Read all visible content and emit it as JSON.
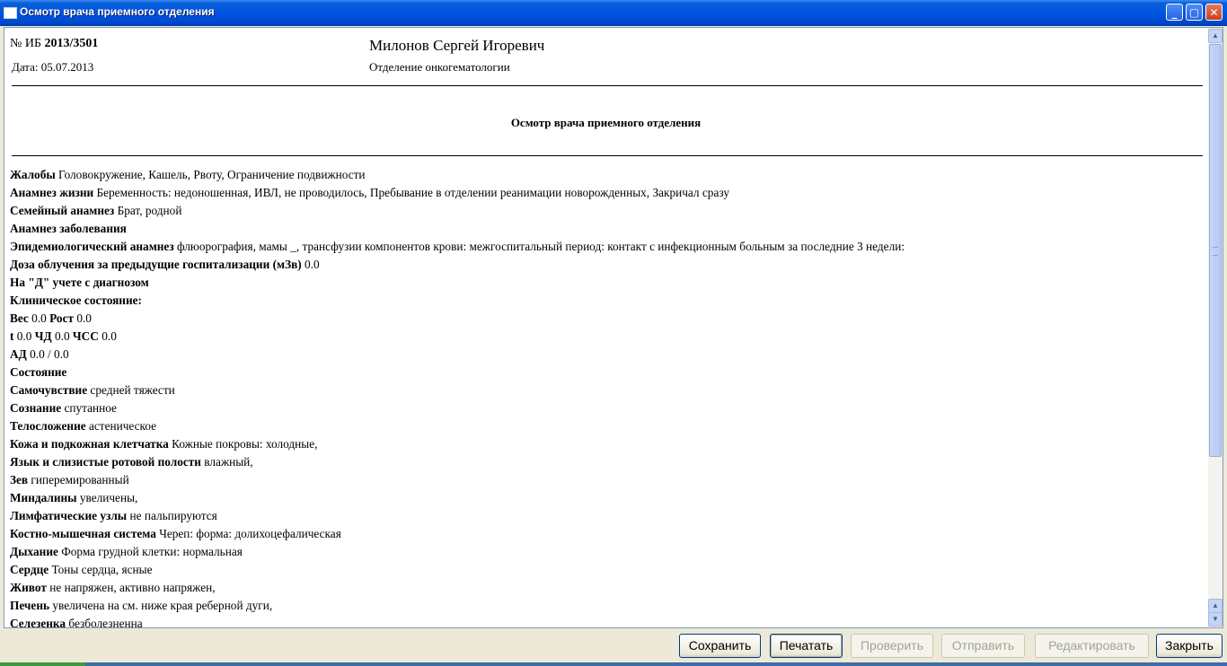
{
  "window": {
    "title": "Осмотр врача приемного отделения",
    "controls": {
      "minimize": "_",
      "maximize": "▢",
      "close": "✕"
    }
  },
  "header": {
    "ib_label": "№ ИБ",
    "ib_number": "2013/3501",
    "date_text": "Дата: 05.07.2013",
    "patient_name": "Милонов Сергей Игоревич",
    "department": "Отделение онкогематологии"
  },
  "document": {
    "title": "Осмотр врача приемного отделения",
    "lines": [
      [
        {
          "b": "Жалобы"
        },
        {
          "t": " Головокружение, Кашель, Рвоту, Ограничение подвижности"
        }
      ],
      [
        {
          "b": "Анамнез жизни"
        },
        {
          "t": " Беременность: недоношенная, ИВЛ, не проводилось, Пребывание в отделении реанимации новорожденных, Закричал сразу"
        }
      ],
      [
        {
          "b": "Семейный анамнез"
        },
        {
          "t": " Брат, родной"
        }
      ],
      [
        {
          "b": "Анамнез заболевания"
        }
      ],
      [
        {
          "b": "Эпидемиологический анамнез"
        },
        {
          "t": " флюорография, мамы _, трансфузии компонентов крови: межгоспитальный период: контакт с инфекционным больным за последние 3 недели:"
        }
      ],
      [
        {
          "b": "Доза облучения за предыдущие госпитализации (мЗв)"
        },
        {
          "t": " 0.0"
        }
      ],
      [
        {
          "b": "На \"Д\" учете с диагнозом"
        }
      ],
      [
        {
          "b": "Клиническое состояние:"
        }
      ],
      [
        {
          "b": "Вес"
        },
        {
          "t": " 0.0 "
        },
        {
          "b": "Рост"
        },
        {
          "t": " 0.0"
        }
      ],
      [
        {
          "b": "t"
        },
        {
          "t": " 0.0 "
        },
        {
          "b": "ЧД"
        },
        {
          "t": " 0.0 "
        },
        {
          "b": "ЧСС"
        },
        {
          "t": " 0.0"
        }
      ],
      [
        {
          "b": "АД"
        },
        {
          "t": " 0.0 / 0.0"
        }
      ],
      [
        {
          "b": "Состояние"
        }
      ],
      [
        {
          "b": "Самочувствие"
        },
        {
          "t": " средней тяжести"
        }
      ],
      [
        {
          "b": "Сознание"
        },
        {
          "t": " спутанное"
        }
      ],
      [
        {
          "b": "Телосложение"
        },
        {
          "t": " астеническое"
        }
      ],
      [
        {
          "b": "Кожа и подкожная клетчатка"
        },
        {
          "t": " Кожные покровы: холодные,"
        }
      ],
      [
        {
          "b": "Язык и слизистые ротовой полости"
        },
        {
          "t": " влажный,"
        }
      ],
      [
        {
          "b": "Зев"
        },
        {
          "t": " гиперемированный"
        }
      ],
      [
        {
          "b": "Миндалины"
        },
        {
          "t": " увеличены,"
        }
      ],
      [
        {
          "b": "Лимфатические узлы"
        },
        {
          "t": " не пальпируются"
        }
      ],
      [
        {
          "b": "Костно-мышечная система"
        },
        {
          "t": " Череп: форма: долихоцефалическая"
        }
      ],
      [
        {
          "b": "Дыхание"
        },
        {
          "t": " Форма грудной клетки: нормальная"
        }
      ],
      [
        {
          "b": "Сердце"
        },
        {
          "t": " Тоны сердца, ясные"
        }
      ],
      [
        {
          "b": "Живот"
        },
        {
          "t": " не напряжен, активно напряжен,"
        }
      ],
      [
        {
          "b": "Печень"
        },
        {
          "t": " увеличена на см. ниже края реберной дуги,"
        }
      ],
      [
        {
          "b": "Селезенка"
        },
        {
          "t": " безболезненна"
        }
      ]
    ]
  },
  "buttons": {
    "save": "Сохранить",
    "print": "Печатать",
    "check": "Проверить",
    "send": "Отправить",
    "edit": "Редактировать",
    "close": "Закрыть"
  }
}
